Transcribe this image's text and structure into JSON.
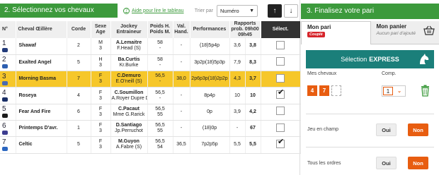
{
  "left": {
    "section_title": "2. Sélectionnez vos chevaux",
    "help_link": "Aide pour lire le tableau",
    "sort_label": "Trier par",
    "sort_value": "Numéro",
    "sort_up": "↑",
    "sort_down": "↓"
  },
  "table": {
    "headers": {
      "num": "N°",
      "cheval": "Cheval Œillère",
      "corde": "Corde",
      "sexe": "Sexe Age",
      "jockey": "Jockey Entraineur",
      "poids_h": "Poids H. Poids M.",
      "val": "Val. Hand.",
      "perf": "Performances",
      "rapports": "Rapports prob. 09h00 09h45",
      "select": "Sélect."
    },
    "rows": [
      {
        "num": "1",
        "jacket": "#223a7a",
        "name": "Shawaf",
        "corde": "2",
        "sexe": "M",
        "age": "3",
        "jockey": "A.Lemaitre",
        "trainer": "F.Head (S)",
        "poids_h": "58",
        "poids_m": "-",
        "val": "-",
        "perf": "(18)5p4p",
        "r1": "3,6",
        "r2": "3,8",
        "checked": false,
        "highlight": false
      },
      {
        "num": "2",
        "jacket": "#2d5fb0",
        "name": "Exalted Angel",
        "corde": "5",
        "sexe": "H",
        "age": "3",
        "jockey": "Ba.Curtis",
        "trainer": "Kr.Burke",
        "poids_h": "58",
        "poids_m": "-",
        "val": "-",
        "perf": "3p2p(18)5p3p",
        "r1": "7,9",
        "r2": "8,3",
        "checked": false,
        "highlight": false
      },
      {
        "num": "3",
        "jacket": "#4a6bb0",
        "name": "Morning Basma",
        "corde": "7",
        "sexe": "F",
        "age": "3",
        "jockey": "C.Demuro",
        "trainer": "E.O'neill (S)",
        "poids_h": "56,5",
        "poids_m": "-",
        "val": "38,0",
        "perf": "2p6p3p(18)2p2p",
        "r1": "4,3",
        "r2": "3,7",
        "checked": false,
        "highlight": true
      },
      {
        "num": "4",
        "jacket": "#1a2f66",
        "name": "Roseya",
        "corde": "4",
        "sexe": "F",
        "age": "3",
        "jockey": "C.Soumillon",
        "trainer": "A.Royer Dupre De",
        "poids_h": "56,5",
        "poids_m": "-",
        "val": "-",
        "perf": "8p4p",
        "r1": "10",
        "r2": "10",
        "checked": true,
        "highlight": false
      },
      {
        "num": "5",
        "jacket": "#1c1c1c",
        "name": "Fear And Fire",
        "corde": "6",
        "sexe": "F",
        "age": "3",
        "jockey": "C.Pacaut",
        "trainer": "Mme G.Rarick",
        "poids_h": "56,5",
        "poids_m": "55",
        "val": "-",
        "perf": "0p",
        "r1": "3,9",
        "r2": "4,2",
        "checked": false,
        "highlight": false
      },
      {
        "num": "6",
        "jacket": "#3d3d90",
        "name": "Printemps D'avr.",
        "corde": "1",
        "sexe": "F",
        "age": "3",
        "jockey": "D.Santiago",
        "trainer": "Jp.Perruchot",
        "poids_h": "56,5",
        "poids_m": "55",
        "val": "-",
        "perf": "(18)0p",
        "r1": "-",
        "r2": "67",
        "checked": false,
        "highlight": false
      },
      {
        "num": "7",
        "jacket": "#2b66c0",
        "name": "Celtic",
        "corde": "5",
        "sexe": "F",
        "age": "3",
        "jockey": "M.Guyon",
        "trainer": "A.Fabre (S)",
        "poids_h": "56,5",
        "poids_m": "54",
        "val": "36,5",
        "perf": "7p2p5p",
        "r1": "5,5",
        "r2": "5,5",
        "checked": true,
        "highlight": false
      }
    ]
  },
  "right": {
    "title": "3. Finalisez votre pari",
    "tab_mon_pari": "Mon pari",
    "coupe": "Couplé",
    "tab_panier": "Mon panier",
    "panier_sub": "Aucun pari d'ajouté",
    "express_label": "Sélection",
    "express_bold": "EXPRESS",
    "mes_chevaux": "Mes chevaux",
    "comp": "Comp.",
    "chips": [
      "4",
      "7"
    ],
    "comp_value": "1",
    "jeu_label": "Jeu en champ",
    "tous_label": "Tous les ordres",
    "oui": "Oui",
    "non": "Non",
    "accent": "#e85d10",
    "brand": "#3c9a3c"
  }
}
